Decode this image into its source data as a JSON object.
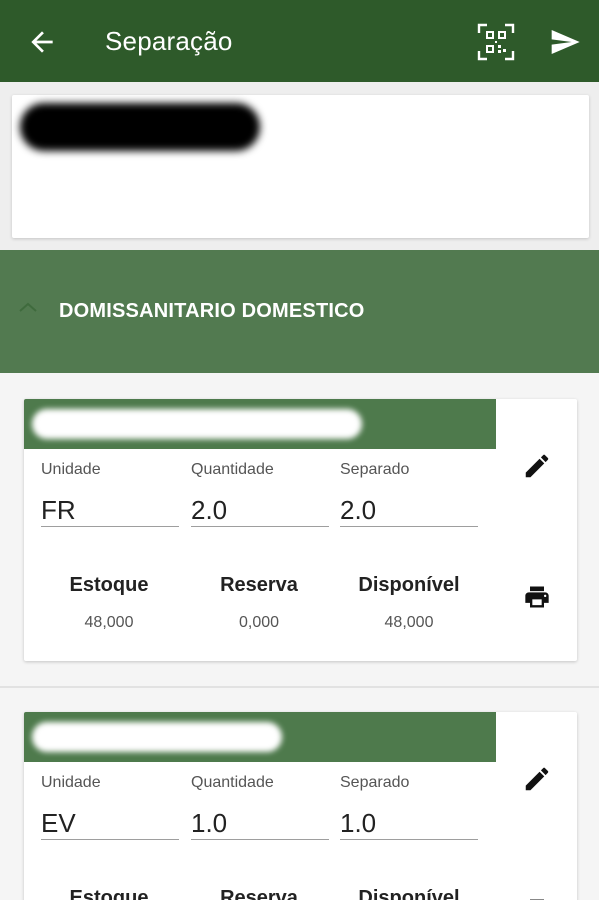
{
  "appbar": {
    "title": "Separação",
    "icons": [
      "arrow-back-icon",
      "qr-code-scan-icon",
      "send-icon"
    ],
    "color": "#2e5a2a"
  },
  "group": {
    "label": "DOMISSANITARIO DOMESTICO",
    "expanded": true,
    "color": "#527a50"
  },
  "labels": {
    "unidade": "Unidade",
    "quantidade": "Quantidade",
    "separado": "Separado",
    "estoque": "Estoque",
    "reserva": "Reserva",
    "disponivel": "Disponível"
  },
  "items": [
    {
      "unidade": "FR",
      "quantidade": "2.0",
      "separado": "2.0",
      "estoque": "48,000",
      "reserva": "0,000",
      "disponivel": "48,000"
    },
    {
      "unidade": "EV",
      "quantidade": "1.0",
      "separado": "1.0"
    }
  ]
}
